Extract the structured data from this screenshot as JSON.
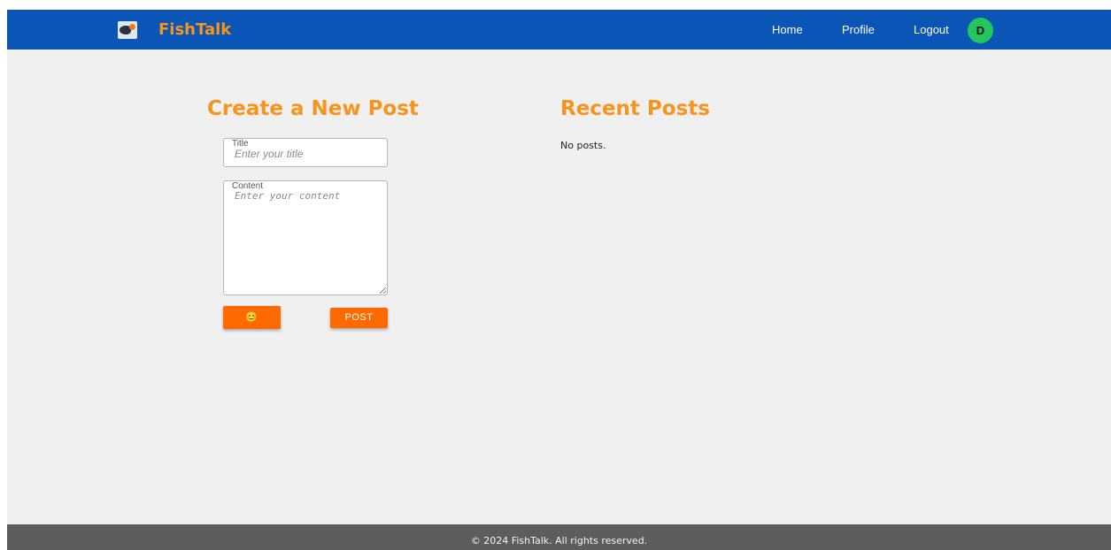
{
  "header": {
    "brand": "FishTalk",
    "nav": {
      "home": "Home",
      "profile": "Profile",
      "logout": "Logout"
    },
    "avatar_initial": "D"
  },
  "create_post": {
    "heading": "Create a New Post",
    "title_label": "Title",
    "title_placeholder": "Enter your title",
    "title_value": "",
    "content_label": "Content",
    "content_placeholder": "Enter your content",
    "content_value": "",
    "emoji_button": "😊",
    "post_button": "POST"
  },
  "recent_posts": {
    "heading": "Recent Posts",
    "empty_text": "No posts."
  },
  "footer": {
    "text": "© 2024 FishTalk. All rights reserved."
  },
  "colors": {
    "navbar": "#0a55b5",
    "brand_accent": "#f7941d",
    "button": "#ff6a00",
    "avatar": "#22c55e",
    "footer": "#5d5d5d",
    "page_background": "#f0f0f0"
  },
  "icons": {
    "logo": "fishtalk-logo-icon",
    "emoji": "smiley-emoji-icon"
  }
}
